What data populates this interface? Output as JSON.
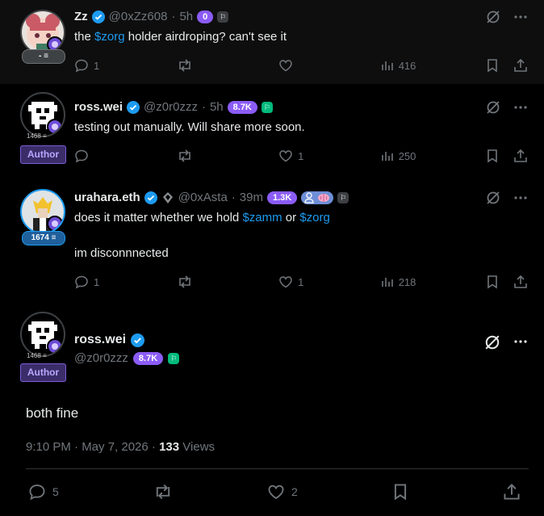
{
  "posts": [
    {
      "name": "Zz",
      "handle": "@0xZz608",
      "time": "5h",
      "xp": "0",
      "body": "the ",
      "link": "$zorg",
      "body2": " holder airdroping? can't see it",
      "level": "- ≡",
      "reply": "1",
      "repost": "",
      "like": "",
      "views": "416"
    },
    {
      "name": "ross.wei",
      "handle": "@z0r0zzz",
      "time": "5h",
      "xp": "8.7K",
      "body": "testing out manually. Will share more soon.",
      "level": "1468 ≡",
      "author": "Author",
      "reply": "",
      "repost": "",
      "like": "1",
      "views": "250"
    },
    {
      "name": "urahara.eth",
      "handle": "@0xAsta",
      "time": "39m",
      "xp": "1.3K",
      "body_a": "does it matter whether we hold ",
      "link_a": "$zamm",
      "body_b": " or ",
      "link_b": "$zorg",
      "body_c": "im disconnnected",
      "level": "1674 ≡",
      "reply": "1",
      "repost": "",
      "like": "1",
      "views": "218"
    },
    {
      "name": "ross.wei",
      "handle": "@z0r0zzz",
      "xp": "8.7K",
      "level": "1468 ≡",
      "author": "Author",
      "body": "both fine",
      "time": "9:10 PM · May 7, 2026",
      "views_count": "133",
      "views_label": "Views",
      "reply": "5",
      "like": "2"
    }
  ],
  "dot": "·",
  "colors": {
    "accent": "#1d9bf0",
    "xp": "#8b5cf6",
    "author": "#7c5cd9"
  }
}
